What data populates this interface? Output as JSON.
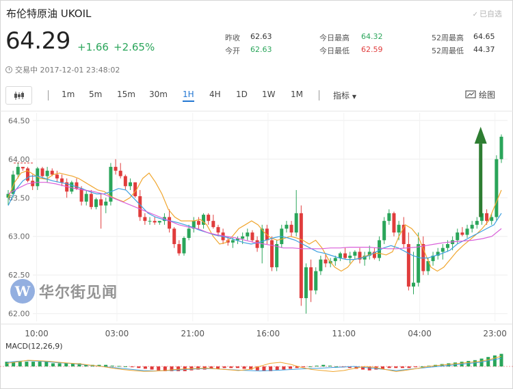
{
  "header": {
    "title": "布伦特原油  UKOIL",
    "watchlist_label": "已自选",
    "price": "64.29",
    "change": "+1.66",
    "change_pct": "+2.65%",
    "trade_status": "交易中 2017-12-01 23:48:02"
  },
  "stats": [
    {
      "label": "昨收",
      "value": "62.63",
      "tone": "neutral"
    },
    {
      "label": "今开",
      "value": "62.63",
      "tone": "green"
    },
    {
      "label": "今日最高",
      "value": "64.32",
      "tone": "green"
    },
    {
      "label": "今日最低",
      "value": "62.59",
      "tone": "red"
    },
    {
      "label": "52周最高",
      "value": "64.65",
      "tone": "neutral"
    },
    {
      "label": "52周最低",
      "value": "44.37",
      "tone": "neutral"
    }
  ],
  "toolbar": {
    "periods": [
      "1m",
      "5m",
      "15m",
      "30m",
      "1H",
      "4H",
      "1D",
      "1W",
      "1M"
    ],
    "active_period": "1H",
    "indicator_label": "指标",
    "draw_label": "绘图"
  },
  "watermark": {
    "logo_letter": "W",
    "text": "华尔街见闻"
  },
  "colors": {
    "up": "#2aa55a",
    "down": "#e03c3c",
    "accent": "#2276d2",
    "ma_orange": "#f0a52c",
    "ma_blue": "#3b9fe0",
    "ma_pink": "#d95fd9"
  },
  "chart_data": {
    "type": "candlestick",
    "y_ticks": [
      "64.50",
      "64.00",
      "63.50",
      "63.00",
      "62.50",
      "62.00"
    ],
    "ylim": [
      61.9,
      64.6
    ],
    "x_ticks": [
      "10:00",
      "03:00",
      "21:00",
      "16:00",
      "11:00",
      "04:00",
      "23:00"
    ],
    "candles": [
      [
        63.5,
        63.6,
        63.4,
        63.55
      ],
      [
        63.55,
        63.85,
        63.5,
        63.8
      ],
      [
        63.8,
        63.95,
        63.75,
        63.9
      ],
      [
        63.9,
        63.9,
        63.85,
        63.88
      ],
      [
        63.88,
        63.9,
        63.7,
        63.72
      ],
      [
        63.72,
        63.8,
        63.6,
        63.65
      ],
      [
        63.65,
        63.9,
        63.6,
        63.88
      ],
      [
        63.88,
        63.9,
        63.75,
        63.78
      ],
      [
        63.78,
        63.9,
        63.7,
        63.85
      ],
      [
        63.85,
        63.88,
        63.78,
        63.8
      ],
      [
        63.8,
        63.85,
        63.7,
        63.75
      ],
      [
        63.75,
        63.8,
        63.65,
        63.7
      ],
      [
        63.7,
        63.75,
        63.5,
        63.58
      ],
      [
        63.58,
        63.72,
        63.55,
        63.7
      ],
      [
        63.7,
        63.75,
        63.6,
        63.62
      ],
      [
        63.62,
        63.65,
        63.4,
        63.45
      ],
      [
        63.45,
        63.6,
        63.4,
        63.55
      ],
      [
        63.55,
        63.6,
        63.35,
        63.38
      ],
      [
        63.38,
        63.5,
        63.35,
        63.48
      ],
      [
        63.48,
        63.55,
        63.1,
        63.4
      ],
      [
        63.4,
        63.5,
        63.3,
        63.45
      ],
      [
        63.45,
        63.95,
        63.4,
        63.9
      ],
      [
        63.9,
        64.0,
        63.8,
        63.85
      ],
      [
        63.85,
        63.95,
        63.75,
        63.78
      ],
      [
        63.78,
        63.8,
        63.6,
        63.65
      ],
      [
        63.65,
        63.75,
        63.6,
        63.7
      ],
      [
        63.7,
        63.7,
        63.5,
        63.52
      ],
      [
        63.52,
        63.6,
        63.2,
        63.25
      ],
      [
        63.25,
        63.3,
        63.15,
        63.2
      ],
      [
        63.2,
        63.25,
        63.15,
        63.2
      ],
      [
        63.2,
        63.25,
        63.15,
        63.18
      ],
      [
        63.18,
        63.2,
        63.15,
        63.2
      ],
      [
        63.2,
        63.3,
        63.15,
        63.25
      ],
      [
        63.25,
        63.35,
        63.05,
        63.1
      ],
      [
        63.1,
        63.12,
        62.85,
        62.9
      ],
      [
        62.9,
        62.95,
        62.75,
        62.78
      ],
      [
        62.78,
        63.0,
        62.75,
        62.98
      ],
      [
        62.98,
        63.15,
        62.95,
        63.1
      ],
      [
        63.1,
        63.25,
        63.05,
        63.2
      ],
      [
        63.2,
        63.25,
        63.1,
        63.15
      ],
      [
        63.15,
        63.3,
        63.1,
        63.28
      ],
      [
        63.28,
        63.3,
        63.15,
        63.2
      ],
      [
        63.2,
        63.28,
        63.1,
        63.12
      ],
      [
        63.12,
        63.15,
        63.0,
        63.05
      ],
      [
        63.05,
        63.1,
        62.9,
        62.95
      ],
      [
        62.95,
        63.0,
        62.88,
        62.92
      ],
      [
        62.92,
        62.98,
        62.85,
        62.95
      ],
      [
        62.95,
        63.0,
        62.9,
        62.97
      ],
      [
        62.97,
        63.05,
        62.9,
        63.0
      ],
      [
        63.0,
        63.1,
        62.95,
        63.05
      ],
      [
        63.05,
        63.08,
        62.92,
        62.95
      ],
      [
        62.95,
        63.0,
        62.8,
        62.85
      ],
      [
        62.85,
        63.15,
        62.65,
        63.1
      ],
      [
        63.1,
        63.15,
        62.9,
        62.95
      ],
      [
        62.95,
        63.0,
        62.55,
        62.6
      ],
      [
        62.6,
        62.95,
        62.55,
        62.9
      ],
      [
        62.9,
        63.15,
        62.85,
        63.1
      ],
      [
        63.1,
        63.2,
        63.05,
        63.15
      ],
      [
        63.15,
        63.2,
        63.0,
        63.05
      ],
      [
        63.05,
        63.6,
        63.0,
        63.3
      ],
      [
        63.3,
        63.4,
        62.1,
        62.2
      ],
      [
        62.2,
        62.65,
        62.0,
        62.6
      ],
      [
        62.6,
        62.7,
        62.15,
        62.3
      ],
      [
        62.3,
        62.6,
        62.25,
        62.55
      ],
      [
        62.55,
        62.75,
        62.5,
        62.7
      ],
      [
        62.7,
        62.78,
        62.6,
        62.65
      ],
      [
        62.65,
        62.72,
        62.6,
        62.68
      ],
      [
        62.68,
        62.75,
        62.62,
        62.72
      ],
      [
        62.72,
        62.8,
        62.68,
        62.78
      ],
      [
        62.78,
        62.85,
        62.7,
        62.72
      ],
      [
        62.72,
        62.8,
        62.65,
        62.75
      ],
      [
        62.75,
        62.82,
        62.7,
        62.8
      ],
      [
        62.8,
        62.85,
        62.65,
        62.7
      ],
      [
        62.7,
        62.8,
        62.62,
        62.75
      ],
      [
        62.75,
        62.88,
        62.7,
        62.8
      ],
      [
        62.8,
        62.85,
        62.7,
        62.72
      ],
      [
        62.72,
        63.0,
        62.68,
        62.95
      ],
      [
        62.95,
        63.25,
        62.9,
        63.2
      ],
      [
        63.2,
        63.35,
        63.15,
        63.3
      ],
      [
        63.3,
        63.32,
        63.0,
        63.05
      ],
      [
        63.05,
        63.2,
        62.95,
        63.15
      ],
      [
        63.15,
        63.25,
        62.85,
        62.9
      ],
      [
        62.9,
        63.05,
        62.3,
        62.35
      ],
      [
        62.35,
        62.8,
        62.25,
        62.4
      ],
      [
        62.4,
        63.05,
        62.35,
        62.9
      ],
      [
        62.9,
        63.0,
        62.5,
        62.55
      ],
      [
        62.55,
        62.72,
        62.5,
        62.68
      ],
      [
        62.68,
        62.8,
        62.62,
        62.75
      ],
      [
        62.75,
        62.85,
        62.7,
        62.8
      ],
      [
        62.8,
        62.9,
        62.7,
        62.85
      ],
      [
        62.85,
        62.95,
        62.8,
        62.9
      ],
      [
        62.9,
        63.0,
        62.82,
        62.95
      ],
      [
        62.95,
        63.1,
        62.9,
        63.05
      ],
      [
        63.05,
        63.12,
        63.0,
        63.02
      ],
      [
        63.02,
        63.15,
        62.98,
        63.1
      ],
      [
        63.1,
        63.2,
        63.05,
        63.15
      ],
      [
        63.15,
        63.25,
        63.1,
        63.2
      ],
      [
        63.2,
        63.35,
        63.15,
        63.3
      ],
      [
        63.3,
        63.35,
        63.15,
        63.2
      ],
      [
        63.2,
        63.3,
        63.15,
        63.25
      ],
      [
        63.25,
        64.05,
        63.2,
        64.0
      ],
      [
        64.0,
        64.32,
        63.95,
        64.29
      ]
    ],
    "ma_series": [
      {
        "color": "#f0a52c",
        "values": [
          63.5,
          63.7,
          63.82,
          63.85,
          63.8,
          63.75,
          63.74,
          63.8,
          63.82,
          63.8,
          63.78,
          63.75,
          63.7,
          63.65,
          63.6,
          63.58,
          63.52,
          63.48,
          63.45,
          63.5,
          63.6,
          63.75,
          63.82,
          63.7,
          63.55,
          63.35,
          63.25,
          63.2,
          63.2,
          63.2,
          63.22,
          63.15,
          63.0,
          62.9,
          62.92,
          63.0,
          63.1,
          63.15,
          63.2,
          63.15,
          63.05,
          62.98,
          62.95,
          62.97,
          63.0,
          62.98,
          62.95,
          62.9,
          62.95,
          62.85,
          62.7,
          62.6,
          62.55,
          62.6,
          62.7,
          62.72,
          62.75,
          62.78,
          62.78,
          62.76,
          62.8,
          63.0,
          63.15,
          63.1,
          63.0,
          62.8,
          62.6,
          62.55,
          62.6,
          62.7,
          62.8,
          62.88,
          62.95,
          63.02,
          63.1,
          63.2,
          63.4,
          63.6
        ]
      },
      {
        "color": "#3b9fe0",
        "values": [
          63.4,
          63.6,
          63.72,
          63.78,
          63.78,
          63.75,
          63.72,
          63.7,
          63.68,
          63.65,
          63.62,
          63.58,
          63.55,
          63.55,
          63.58,
          63.62,
          63.6,
          63.5,
          63.4,
          63.3,
          63.25,
          63.22,
          63.2,
          63.18,
          63.15,
          63.12,
          63.08,
          63.05,
          63.02,
          63.0,
          62.98,
          62.95,
          62.92,
          62.9,
          62.92,
          62.95,
          62.98,
          63.0,
          62.98,
          62.95,
          62.9,
          62.85,
          62.8,
          62.78,
          62.75,
          62.72,
          62.7,
          62.7,
          62.72,
          62.75,
          62.8,
          62.85,
          62.88,
          62.85,
          62.8,
          62.75,
          62.72,
          62.72,
          62.75,
          62.78,
          62.82,
          62.9,
          62.95,
          63.0,
          63.05,
          63.1,
          63.15,
          63.3
        ]
      },
      {
        "color": "#d95fd9",
        "values": [
          63.55,
          63.62,
          63.68,
          63.7,
          63.7,
          63.68,
          63.65,
          63.62,
          63.6,
          63.58,
          63.55,
          63.5,
          63.45,
          63.4,
          63.35,
          63.3,
          63.25,
          63.2,
          63.15,
          63.12,
          63.1,
          63.05,
          63.02,
          63.0,
          62.98,
          62.95,
          62.92,
          62.9,
          62.88,
          62.85,
          62.85,
          62.84,
          62.84,
          62.84,
          62.85,
          62.85,
          62.86,
          62.86,
          62.86,
          62.85,
          62.84,
          62.84,
          62.85,
          62.86,
          62.88,
          62.9,
          62.92,
          62.93,
          62.94,
          62.95,
          62.97,
          63.0,
          63.1
        ]
      }
    ],
    "annotations": [
      {
        "type": "arrow",
        "direction": "up",
        "color": "#2e7d32",
        "at_candle": 99
      }
    ],
    "macd_label": "MACD(12,26,9)",
    "macd_hist": [
      3,
      3,
      3,
      3,
      3,
      3,
      3,
      2,
      2,
      2,
      2,
      2,
      1,
      1,
      1,
      1,
      0.5,
      0.3,
      0,
      -0.5,
      -1,
      -1.5,
      -2,
      -2.5,
      -3,
      -3,
      -3,
      -3,
      -2.5,
      -2,
      -2,
      -1.5,
      -1.5,
      -1,
      -1,
      -1,
      -1.5,
      -2,
      -2.5,
      -3,
      -3,
      -2.5,
      -2,
      -1.5,
      -1,
      -0.5,
      0,
      0.5,
      1,
      0.5,
      0,
      -0.5,
      -1,
      -1.5,
      -2,
      -2.5,
      -2,
      -1.5,
      -1,
      -1,
      -1,
      -1,
      -0.5,
      0,
      0.5,
      1,
      1.5,
      2,
      2.5,
      3,
      3.5,
      4,
      5,
      6,
      7,
      8
    ],
    "macd_lines": [
      {
        "color": "#3b9fe0",
        "values": [
          2,
          2.5,
          2.8,
          2.6,
          2.2,
          1.8,
          1.5,
          1,
          0.5,
          0,
          -0.5,
          -1,
          -1.5,
          -2,
          -2.2,
          -2,
          -1.8,
          -1.5,
          -1.2,
          -1,
          -1.2,
          -1.5,
          -1.8,
          -2,
          -2.2,
          -2,
          -1.8,
          -1.5,
          -1.2,
          -1,
          -0.8,
          -0.5,
          -0.3,
          0,
          -0.5,
          -1,
          -1.5,
          -2,
          -1.5,
          -1,
          -0.5,
          0,
          0.5,
          1,
          1.5,
          2,
          3,
          4
        ]
      },
      {
        "color": "#f0a52c",
        "values": [
          1.5,
          2.2,
          3,
          2.8,
          2.5,
          2,
          1.6,
          1.2,
          0.6,
          0,
          -0.8,
          -1.5,
          -2,
          -2.4,
          -2.3,
          -2,
          -1.5,
          -1.2,
          -1,
          -0.8,
          -1.2,
          -1.6,
          -2,
          -1.5,
          0,
          1.5,
          2,
          1,
          -0.5,
          -1.5,
          -2,
          -2.5,
          -2,
          -1,
          0,
          -0.5,
          -1.5,
          -2.5,
          -1.8,
          -1,
          0,
          0.5,
          1,
          1.5,
          2,
          2.5,
          3.5,
          5
        ]
      }
    ]
  }
}
